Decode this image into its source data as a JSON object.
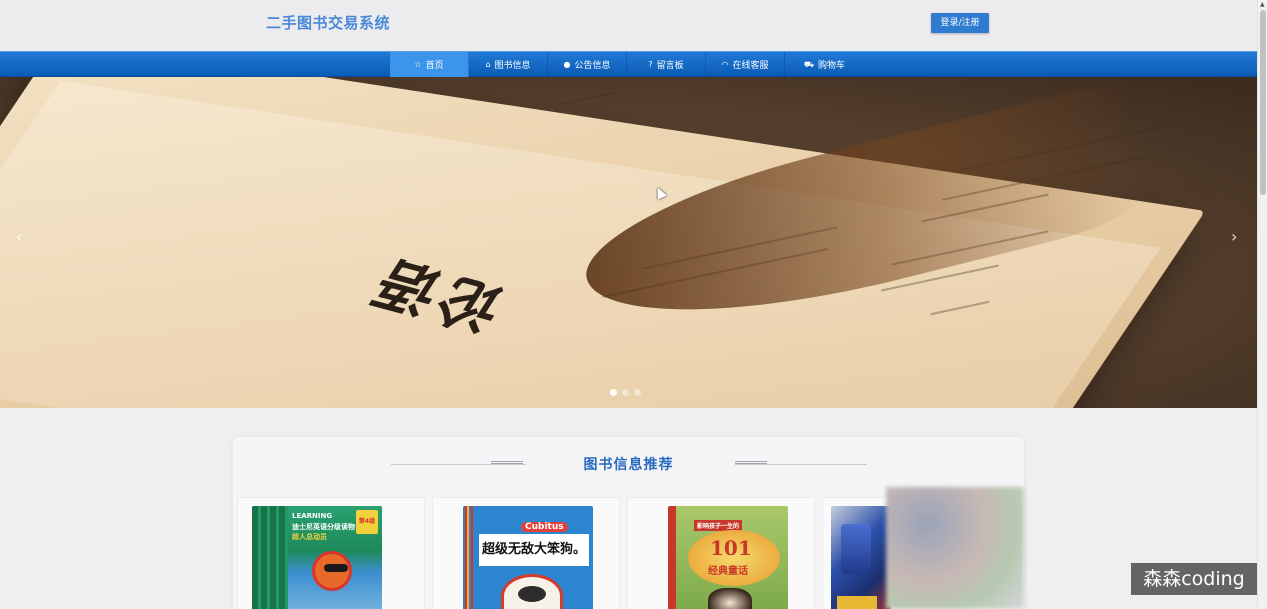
{
  "header": {
    "site_title": "二手图书交易系统",
    "login_label": "登录/注册"
  },
  "nav": {
    "items": [
      {
        "label": "首页",
        "icon": "star-icon",
        "glyph": "☆",
        "active": true
      },
      {
        "label": "图书信息",
        "icon": "bag-icon",
        "glyph": "⌂",
        "active": false
      },
      {
        "label": "公告信息",
        "icon": "info-icon",
        "glyph": "●",
        "active": false
      },
      {
        "label": "留言板",
        "icon": "question-icon",
        "glyph": "?",
        "active": false
      },
      {
        "label": "在线客服",
        "icon": "headset-icon",
        "glyph": "◠",
        "active": false
      },
      {
        "label": "购物车",
        "icon": "cart-icon",
        "glyph": "⛟",
        "active": false
      }
    ]
  },
  "banner": {
    "glyph_text": "论语",
    "prev_arrow": "‹",
    "next_arrow": "›",
    "slide_count": 3,
    "active_slide": 1
  },
  "section": {
    "title": "图书信息推荐",
    "books": [
      {
        "cover_brand": "LEARNING",
        "cover_title": "迪士尼英语分级读物",
        "cover_subtitle": "超人总动员",
        "badge": "第4级",
        "colors": [
          "#1d8a5a",
          "#f2d23c",
          "#d9352b"
        ]
      },
      {
        "cover_brand": "Cubitus",
        "cover_title": "超级无敌大笨狗。",
        "cover_subtitle": "",
        "badge": "",
        "colors": [
          "#2c86cf",
          "#ffffff",
          "#d63a2d"
        ]
      },
      {
        "cover_brand": "",
        "cover_title": "101",
        "cover_subtitle": "经典童话",
        "badge": "影响孩子一生的",
        "colors": [
          "#7aa84a",
          "#e89a2e",
          "#c7382a"
        ]
      },
      {
        "cover_brand": "",
        "cover_title": "",
        "cover_subtitle": "",
        "badge": "",
        "colors": [
          "#2a4fa8",
          "#cfd6e2",
          "#b8332e"
        ]
      }
    ]
  },
  "watermark": "森森coding"
}
